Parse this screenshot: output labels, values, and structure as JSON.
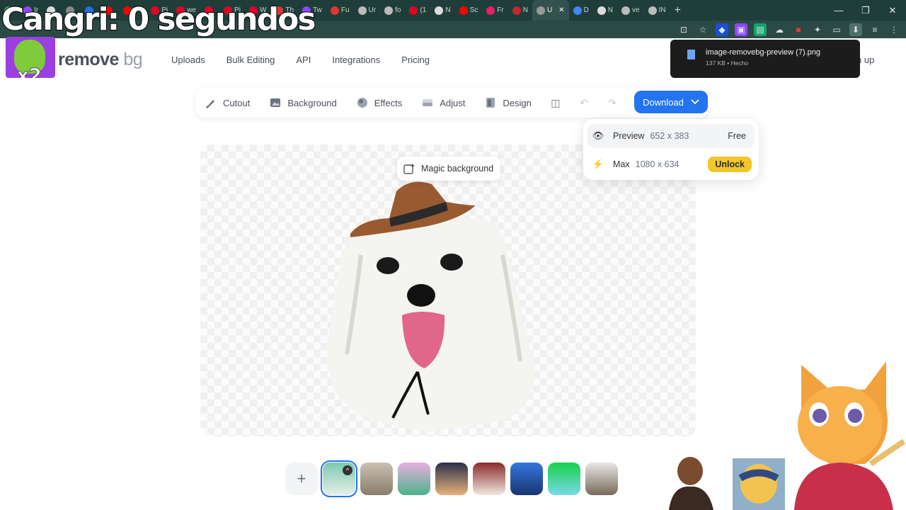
{
  "overlay": {
    "stream_title": "Cangri: 0 segundos",
    "multiplier": "x2"
  },
  "browser": {
    "tabs": [
      {
        "label": "",
        "color": "#3ea36a"
      },
      {
        "label": "Ir",
        "color": "#9146ff"
      },
      {
        "label": "",
        "color": "#dddddd"
      },
      {
        "label": "",
        "color": "#888888"
      },
      {
        "label": "",
        "color": "#1a73e8"
      },
      {
        "label": "",
        "color": "#ff0000"
      },
      {
        "label": "Dc",
        "color": "#ff0000"
      },
      {
        "label": "Pi",
        "color": "#e60023"
      },
      {
        "label": "we",
        "color": "#e60023"
      },
      {
        "label": "",
        "color": "#e60023"
      },
      {
        "label": "Pi",
        "color": "#e60023"
      },
      {
        "label": "W",
        "color": "#e60023"
      },
      {
        "label": "Th",
        "color": "#e3342f"
      },
      {
        "label": "Tw",
        "color": "#9146ff"
      },
      {
        "label": "Fu",
        "color": "#e3342f"
      },
      {
        "label": "Ur",
        "color": "#bbbbbb"
      },
      {
        "label": "fo",
        "color": "#bbbbbb"
      },
      {
        "label": "(1",
        "color": "#e60023"
      },
      {
        "label": "N",
        "color": "#dddddd"
      },
      {
        "label": "Sc",
        "color": "#ff0000"
      },
      {
        "label": "Fr",
        "color": "#e91e63"
      },
      {
        "label": "N",
        "color": "#c62828"
      },
      {
        "label": "U",
        "color": "#999999",
        "active": true
      },
      {
        "label": "D",
        "color": "#4285f4"
      },
      {
        "label": "N",
        "color": "#dddddd"
      },
      {
        "label": "ve",
        "color": "#bbbbbb"
      },
      {
        "label": "IN",
        "color": "#bbbbbb"
      }
    ],
    "new_tab": "+",
    "window_controls": [
      "—",
      "❐",
      "✕"
    ],
    "notification": {
      "filename": "image-removebg-preview (7).png",
      "meta": "137 KB • Hecho"
    }
  },
  "site": {
    "logo_main": "remove",
    "logo_bg": "bg",
    "nav": [
      "Uploads",
      "Bulk Editing",
      "API",
      "Integrations",
      "Pricing"
    ],
    "signup": "n up"
  },
  "editor": {
    "tools": [
      {
        "label": "Cutout",
        "icon": "brush-icon"
      },
      {
        "label": "Background",
        "icon": "image-icon"
      },
      {
        "label": "Effects",
        "icon": "circle-icon"
      },
      {
        "label": "Adjust",
        "icon": "sliders-icon"
      },
      {
        "label": "Design",
        "icon": "layout-icon"
      }
    ],
    "download_label": "Download",
    "download_menu": {
      "preview_label": "Preview",
      "preview_dims": "652 x 383",
      "preview_price": "Free",
      "max_label": "Max",
      "max_dims": "1080 x 634",
      "max_action": "Unlock"
    },
    "magic_background": "Magic background",
    "add_label": "+"
  },
  "colors": {
    "accent": "#2374f0",
    "unlock": "#f2c72b",
    "chrome_dark": "#1f3e39"
  }
}
